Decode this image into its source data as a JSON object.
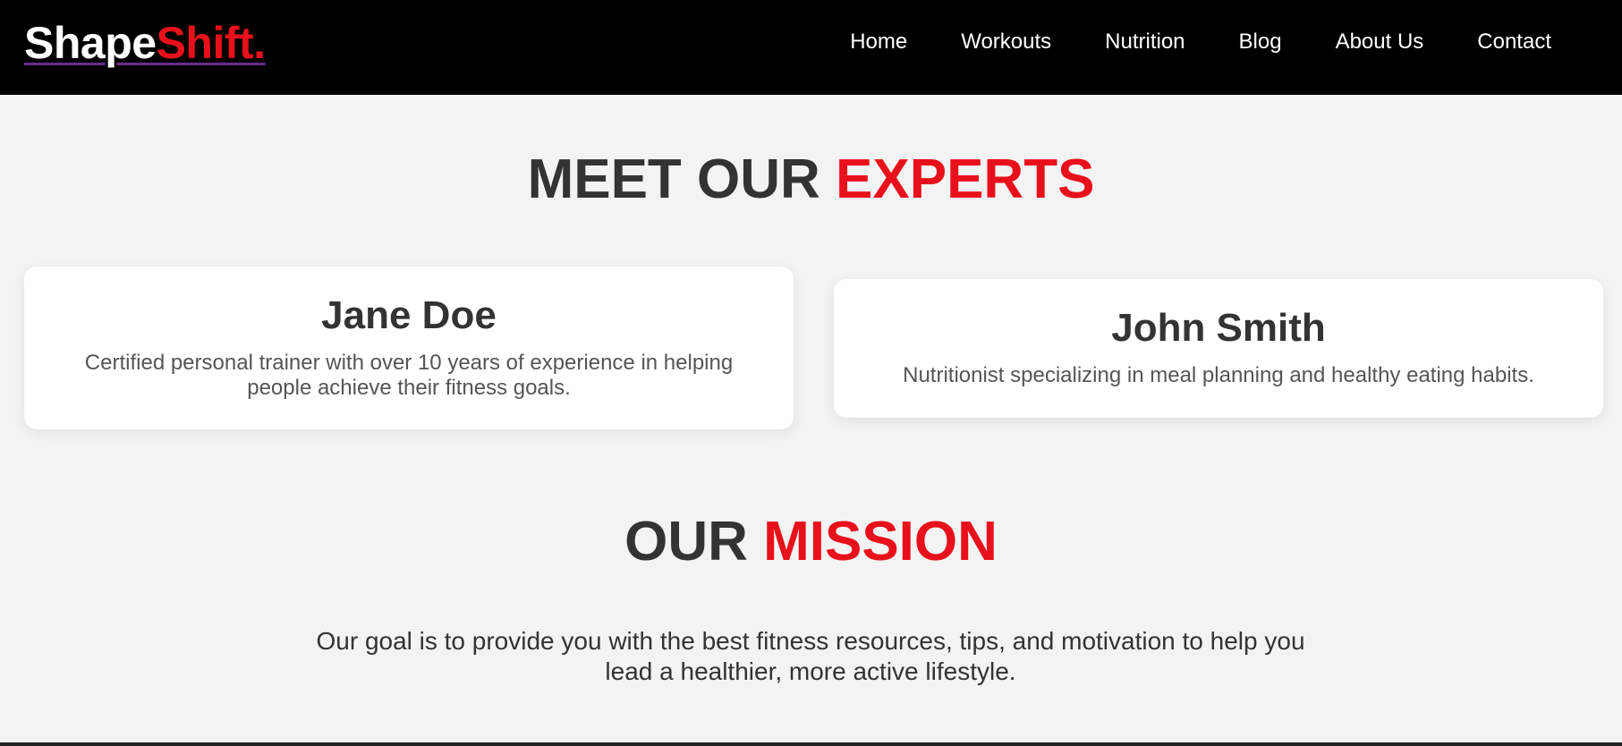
{
  "brand": {
    "part_a": "Shape",
    "part_b": "Shift."
  },
  "nav": {
    "items": [
      {
        "label": "Home"
      },
      {
        "label": "Workouts"
      },
      {
        "label": "Nutrition"
      },
      {
        "label": "Blog"
      },
      {
        "label": "About Us"
      },
      {
        "label": "Contact"
      }
    ]
  },
  "experts": {
    "title_main": "MEET OUR ",
    "title_accent": "EXPERTS",
    "cards": [
      {
        "name": "Jane Doe",
        "description": "Certified personal trainer with over 10 years of experience in helping people achieve their fitness goals."
      },
      {
        "name": "John Smith",
        "description": "Nutritionist specializing in meal planning and healthy eating habits."
      }
    ]
  },
  "mission": {
    "title_main": "OUR ",
    "title_accent": "MISSION",
    "text": "Our goal is to provide you with the best fitness resources, tips, and motivation to help you lead a healthier, more active lifestyle."
  },
  "colors": {
    "navbar_bg": "#000000",
    "accent": "#e8101a",
    "logo_underline": "#6a2c91",
    "page_bg": "#f3f3f3",
    "heading_text": "#333333"
  }
}
